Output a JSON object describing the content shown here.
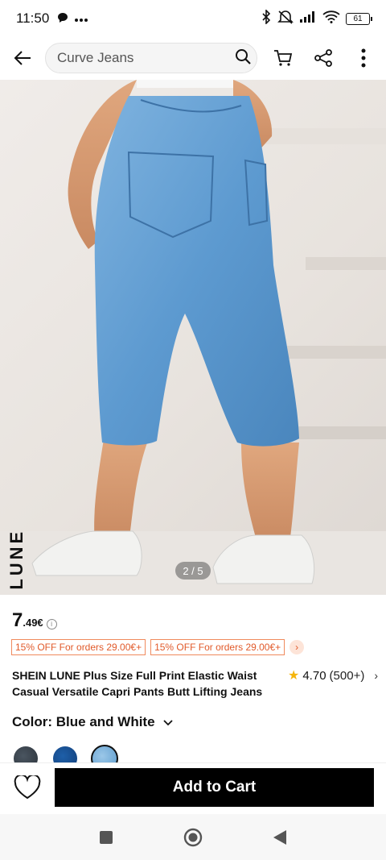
{
  "status": {
    "time": "11:50",
    "battery": "61"
  },
  "search": {
    "value": "Curve Jeans"
  },
  "hero": {
    "brand_text": "SHEIN LUNE",
    "page_indicator": "2 / 5"
  },
  "price": {
    "integer": "7",
    "decimal": ".49€"
  },
  "promos": [
    "15% OFF For orders 29.00€+",
    "15% OFF For orders 29.00€+"
  ],
  "product": {
    "title": "SHEIN LUNE Plus Size Full Print Elastic Waist Casual Versatile Capri Pants Butt Lifting Jeans",
    "rating": "4.70",
    "rating_count": "(500+)"
  },
  "color": {
    "label": "Color: Blue and White"
  },
  "bottom": {
    "add_to_cart": "Add to Cart"
  },
  "colors": {
    "accent_promo": "#e15a2a",
    "star": "#f5b50b",
    "cta_bg": "#000000"
  }
}
